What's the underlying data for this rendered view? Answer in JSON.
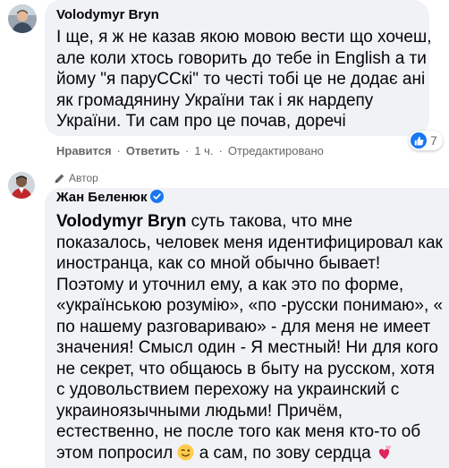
{
  "comment1": {
    "author": "Volodymyr Bryn",
    "text": "І ще, я ж не казав якою мовою вести що хочеш, але коли хтось говорить до тебе in English а ти йому \"я паруССкі\" то честі тобі це не додає ані як громадянину України так і як нардепу України. Ти сам про це почав, доречі",
    "actions": {
      "like": "Нравится",
      "reply": "Ответить",
      "time": "1 ч.",
      "edited": "Отредактировано"
    },
    "reactions": {
      "icon": "like-thumb-icon",
      "count": "7"
    }
  },
  "comment2": {
    "badge": "Автор",
    "author": "Жан Беленюк",
    "mention": "Volodymyr Bryn",
    "text_part1": " суть такова, что мне показалось, человек меня идентифицировал как иностранца, как со мной обычно бывает! Поэтому и уточнил ему, а как это по форме, «українською розумію», «по -русски понимаю», « по нашему разговариваю» - для меня не имеет значения! Смысл один - Я местный! Ни для кого не секрет, что общаюсь в быту на русском, хотя с удовольствием перехожу на украинский с украиноязычными людьми! Причём, естественно, не после того как меня кто-то об этом попросил",
    "text_part2": " а сам, по зову сердца "
  },
  "colors": {
    "accent": "#1877f2",
    "bubble": "#f0f2f5",
    "muted": "#65676b"
  }
}
